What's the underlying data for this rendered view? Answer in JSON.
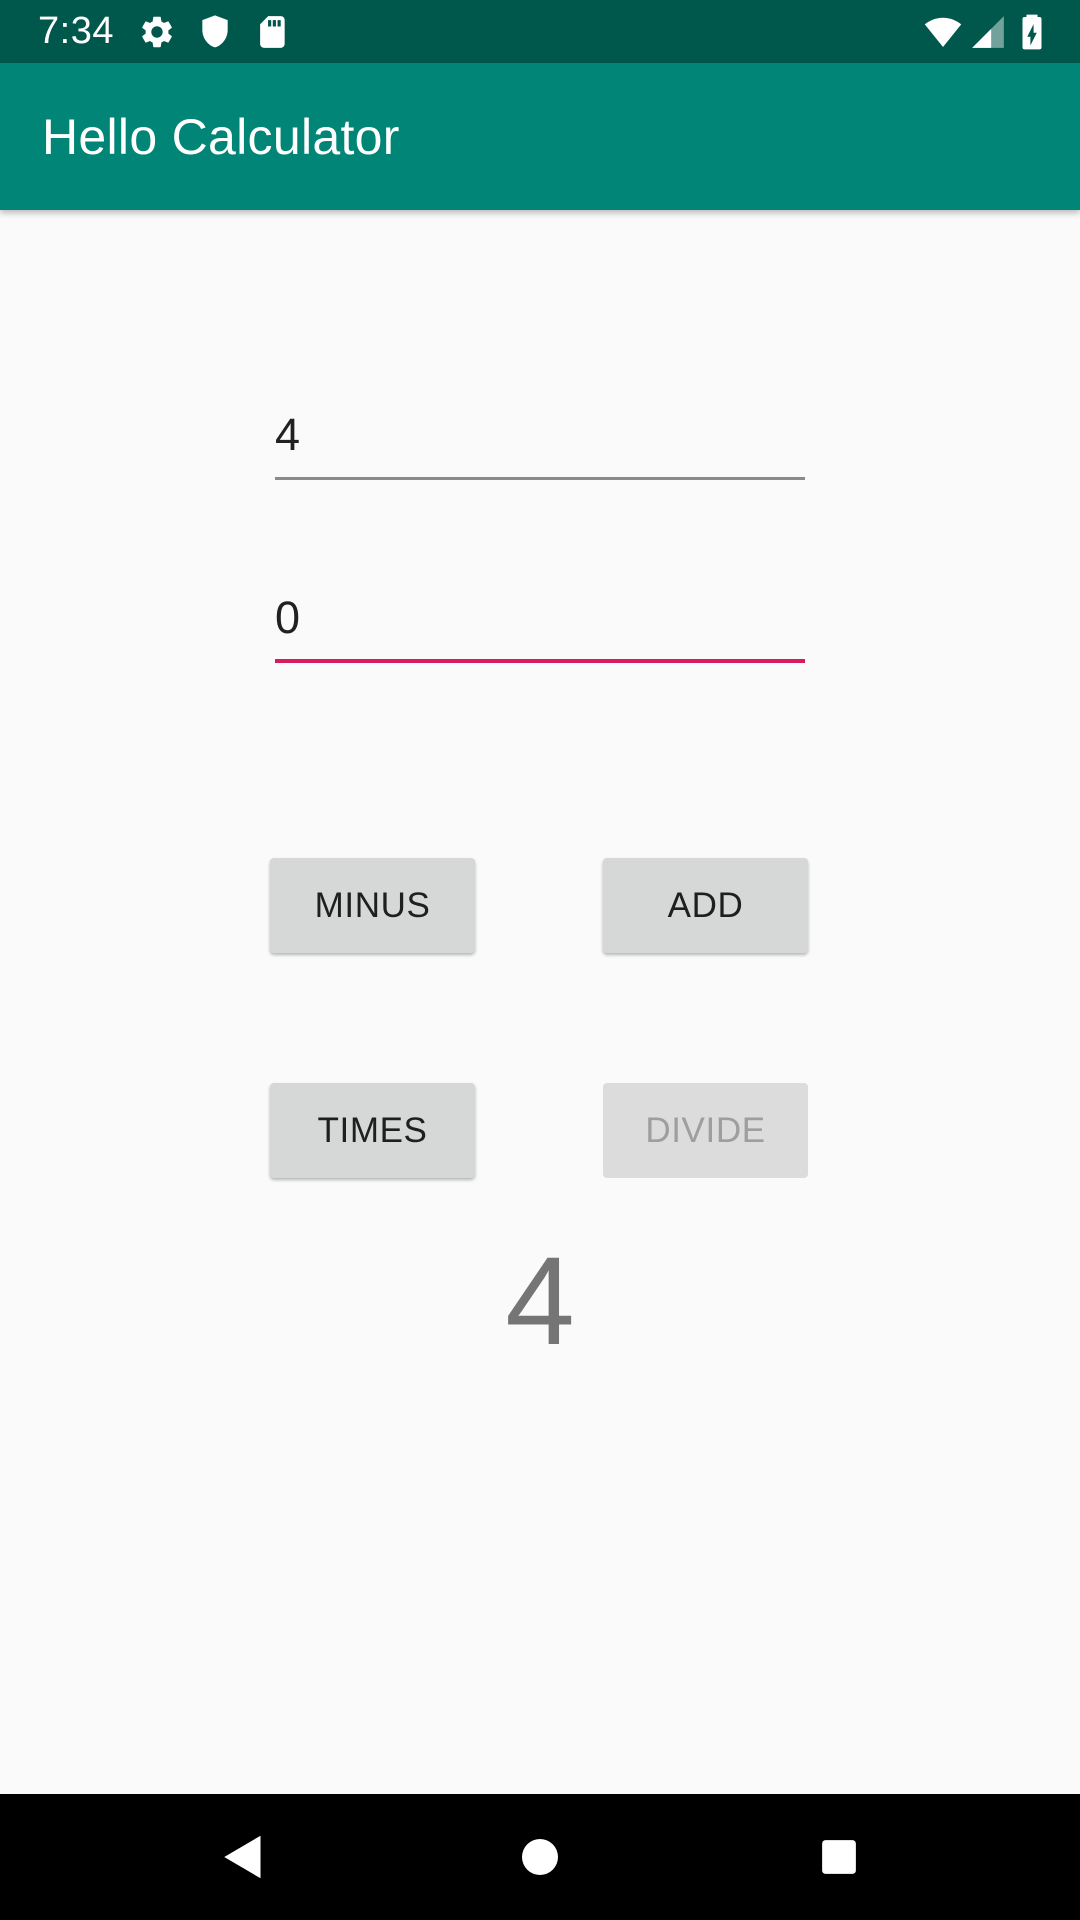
{
  "status_bar": {
    "time": "7:34",
    "left_icons": [
      "gear-icon",
      "shield-icon",
      "sd-card-icon"
    ],
    "right_icons": [
      "wifi-icon",
      "cellular-signal-icon",
      "battery-charging-icon"
    ]
  },
  "app_bar": {
    "title": "Hello Calculator",
    "color": "#008577",
    "status_color": "#00574b"
  },
  "form": {
    "first_number": "4",
    "second_number": "0",
    "focused_field": "second_number",
    "accent_color": "#d81b60"
  },
  "buttons": {
    "minus": "MINUS",
    "add": "ADD",
    "times": "TIMES",
    "divide": "DIVIDE",
    "divide_enabled": false
  },
  "result": {
    "value": "4"
  },
  "nav_bar": {
    "icons": [
      "back-icon",
      "home-icon",
      "recents-icon"
    ]
  }
}
